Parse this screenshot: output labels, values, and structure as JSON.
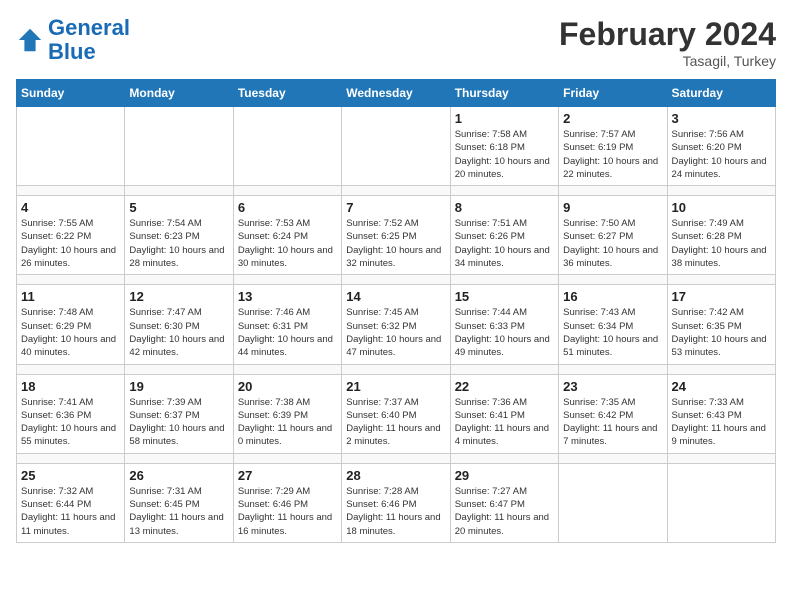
{
  "header": {
    "logo_line1": "General",
    "logo_line2": "Blue",
    "month": "February 2024",
    "location": "Tasagil, Turkey"
  },
  "weekdays": [
    "Sunday",
    "Monday",
    "Tuesday",
    "Wednesday",
    "Thursday",
    "Friday",
    "Saturday"
  ],
  "weeks": [
    [
      {
        "day": "",
        "info": ""
      },
      {
        "day": "",
        "info": ""
      },
      {
        "day": "",
        "info": ""
      },
      {
        "day": "",
        "info": ""
      },
      {
        "day": "1",
        "info": "Sunrise: 7:58 AM\nSunset: 6:18 PM\nDaylight: 10 hours\nand 20 minutes."
      },
      {
        "day": "2",
        "info": "Sunrise: 7:57 AM\nSunset: 6:19 PM\nDaylight: 10 hours\nand 22 minutes."
      },
      {
        "day": "3",
        "info": "Sunrise: 7:56 AM\nSunset: 6:20 PM\nDaylight: 10 hours\nand 24 minutes."
      }
    ],
    [
      {
        "day": "4",
        "info": "Sunrise: 7:55 AM\nSunset: 6:22 PM\nDaylight: 10 hours\nand 26 minutes."
      },
      {
        "day": "5",
        "info": "Sunrise: 7:54 AM\nSunset: 6:23 PM\nDaylight: 10 hours\nand 28 minutes."
      },
      {
        "day": "6",
        "info": "Sunrise: 7:53 AM\nSunset: 6:24 PM\nDaylight: 10 hours\nand 30 minutes."
      },
      {
        "day": "7",
        "info": "Sunrise: 7:52 AM\nSunset: 6:25 PM\nDaylight: 10 hours\nand 32 minutes."
      },
      {
        "day": "8",
        "info": "Sunrise: 7:51 AM\nSunset: 6:26 PM\nDaylight: 10 hours\nand 34 minutes."
      },
      {
        "day": "9",
        "info": "Sunrise: 7:50 AM\nSunset: 6:27 PM\nDaylight: 10 hours\nand 36 minutes."
      },
      {
        "day": "10",
        "info": "Sunrise: 7:49 AM\nSunset: 6:28 PM\nDaylight: 10 hours\nand 38 minutes."
      }
    ],
    [
      {
        "day": "11",
        "info": "Sunrise: 7:48 AM\nSunset: 6:29 PM\nDaylight: 10 hours\nand 40 minutes."
      },
      {
        "day": "12",
        "info": "Sunrise: 7:47 AM\nSunset: 6:30 PM\nDaylight: 10 hours\nand 42 minutes."
      },
      {
        "day": "13",
        "info": "Sunrise: 7:46 AM\nSunset: 6:31 PM\nDaylight: 10 hours\nand 44 minutes."
      },
      {
        "day": "14",
        "info": "Sunrise: 7:45 AM\nSunset: 6:32 PM\nDaylight: 10 hours\nand 47 minutes."
      },
      {
        "day": "15",
        "info": "Sunrise: 7:44 AM\nSunset: 6:33 PM\nDaylight: 10 hours\nand 49 minutes."
      },
      {
        "day": "16",
        "info": "Sunrise: 7:43 AM\nSunset: 6:34 PM\nDaylight: 10 hours\nand 51 minutes."
      },
      {
        "day": "17",
        "info": "Sunrise: 7:42 AM\nSunset: 6:35 PM\nDaylight: 10 hours\nand 53 minutes."
      }
    ],
    [
      {
        "day": "18",
        "info": "Sunrise: 7:41 AM\nSunset: 6:36 PM\nDaylight: 10 hours\nand 55 minutes."
      },
      {
        "day": "19",
        "info": "Sunrise: 7:39 AM\nSunset: 6:37 PM\nDaylight: 10 hours\nand 58 minutes."
      },
      {
        "day": "20",
        "info": "Sunrise: 7:38 AM\nSunset: 6:39 PM\nDaylight: 11 hours\nand 0 minutes."
      },
      {
        "day": "21",
        "info": "Sunrise: 7:37 AM\nSunset: 6:40 PM\nDaylight: 11 hours\nand 2 minutes."
      },
      {
        "day": "22",
        "info": "Sunrise: 7:36 AM\nSunset: 6:41 PM\nDaylight: 11 hours\nand 4 minutes."
      },
      {
        "day": "23",
        "info": "Sunrise: 7:35 AM\nSunset: 6:42 PM\nDaylight: 11 hours\nand 7 minutes."
      },
      {
        "day": "24",
        "info": "Sunrise: 7:33 AM\nSunset: 6:43 PM\nDaylight: 11 hours\nand 9 minutes."
      }
    ],
    [
      {
        "day": "25",
        "info": "Sunrise: 7:32 AM\nSunset: 6:44 PM\nDaylight: 11 hours\nand 11 minutes."
      },
      {
        "day": "26",
        "info": "Sunrise: 7:31 AM\nSunset: 6:45 PM\nDaylight: 11 hours\nand 13 minutes."
      },
      {
        "day": "27",
        "info": "Sunrise: 7:29 AM\nSunset: 6:46 PM\nDaylight: 11 hours\nand 16 minutes."
      },
      {
        "day": "28",
        "info": "Sunrise: 7:28 AM\nSunset: 6:46 PM\nDaylight: 11 hours\nand 18 minutes."
      },
      {
        "day": "29",
        "info": "Sunrise: 7:27 AM\nSunset: 6:47 PM\nDaylight: 11 hours\nand 20 minutes."
      },
      {
        "day": "",
        "info": ""
      },
      {
        "day": "",
        "info": ""
      }
    ]
  ]
}
